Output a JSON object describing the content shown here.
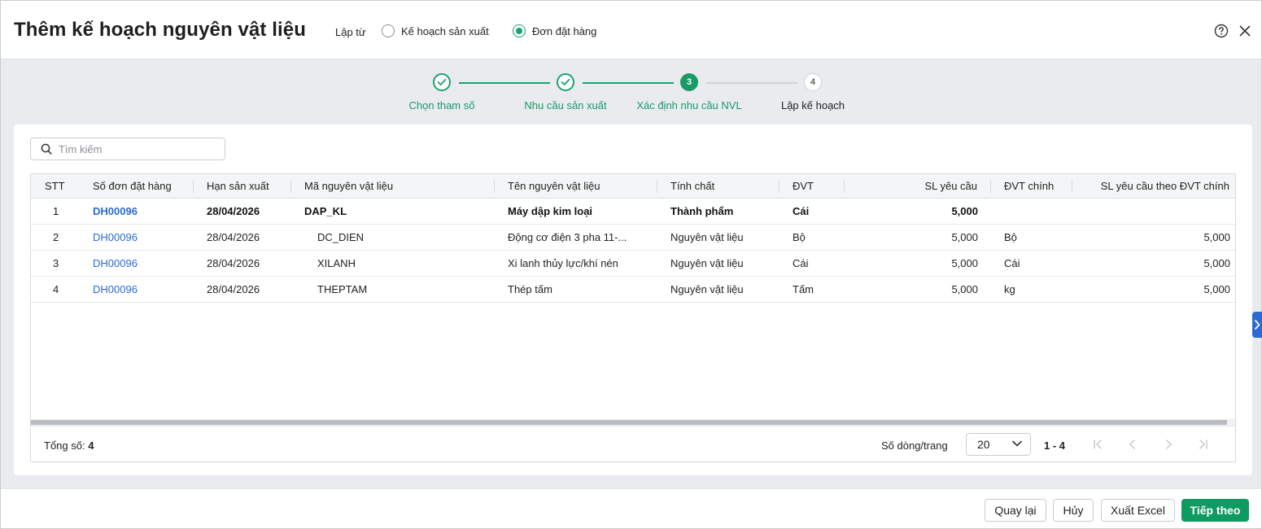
{
  "dialog": {
    "title": "Thêm kế hoạch nguyên vật liệu",
    "source_label": "Lập từ",
    "source_options": [
      {
        "label": "Kế hoạch sản xuất",
        "checked": false
      },
      {
        "label": "Đơn đặt hàng",
        "checked": true
      }
    ],
    "help_icon": "help-icon",
    "close_icon": "close-icon"
  },
  "steps": [
    {
      "label": "Chọn tham số",
      "state": "done"
    },
    {
      "label": "Nhu cầu sản xuất",
      "state": "done"
    },
    {
      "number": "3",
      "label": "Xác định nhu cầu NVL",
      "state": "active"
    },
    {
      "number": "4",
      "label": "Lập kế hoạch",
      "state": "todo"
    }
  ],
  "colors": {
    "accent": "#1aa36b",
    "primary_button": "#0f9a62",
    "link": "#2a6ad6",
    "todo_line": "#d0d3d7"
  },
  "search": {
    "placeholder": "Tìm kiếm",
    "value": ""
  },
  "table": {
    "columns": [
      "STT",
      "Số đơn đặt hàng",
      "Hạn sản xuất",
      "Mã nguyên vật liệu",
      "Tên nguyên vật liệu",
      "Tính chất",
      "ĐVT",
      "SL yêu cầu",
      "ĐVT chính",
      "SL yêu cầu theo ĐVT chính"
    ],
    "rows": [
      {
        "stt": "1",
        "order": "DH00096",
        "deadline": "28/04/2026",
        "code": "DAP_KL",
        "name": "Máy dập kim loại",
        "nature": "Thành phẩm",
        "unit": "Cái",
        "qty": "5,000",
        "main_unit": "",
        "main_qty": "",
        "parent": true
      },
      {
        "stt": "2",
        "order": "DH00096",
        "deadline": "28/04/2026",
        "code": "DC_DIEN",
        "name": "Động cơ điện 3 pha 11-...",
        "nature": "Nguyên vật liệu",
        "unit": "Bộ",
        "qty": "5,000",
        "main_unit": "Bộ",
        "main_qty": "5,000",
        "parent": false
      },
      {
        "stt": "3",
        "order": "DH00096",
        "deadline": "28/04/2026",
        "code": "XILANH",
        "name": "Xi lanh thủy lực/khí nén",
        "nature": "Nguyên vật liệu",
        "unit": "Cái",
        "qty": "5,000",
        "main_unit": "Cái",
        "main_qty": "5,000",
        "parent": false
      },
      {
        "stt": "4",
        "order": "DH00096",
        "deadline": "28/04/2026",
        "code": "THEPTAM",
        "name": "Thép tấm",
        "nature": "Nguyên vật liệu",
        "unit": "Tấm",
        "qty": "5,000",
        "main_unit": "kg",
        "main_qty": "5,000",
        "parent": false
      }
    ]
  },
  "pagination": {
    "total_label": "Tổng số:",
    "total": "4",
    "rows_per_page_label": "Số dòng/trang",
    "rows_per_page": "20",
    "range": "1 - 4"
  },
  "footer": {
    "back": "Quay lại",
    "cancel": "Hủy",
    "export": "Xuất Excel",
    "next": "Tiếp theo"
  }
}
